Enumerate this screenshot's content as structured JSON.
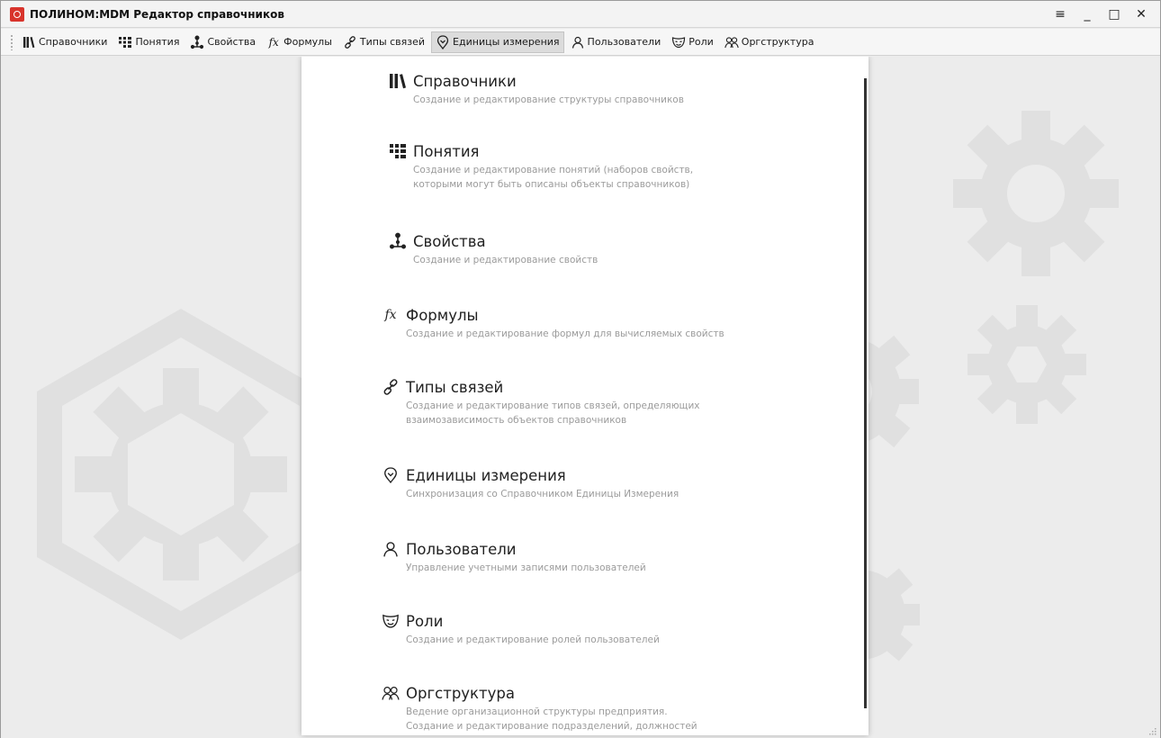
{
  "window": {
    "title": "ПОЛИНОМ:MDM Редактор справочников",
    "controls": [
      "≡",
      "_",
      "□",
      "✕"
    ]
  },
  "toolbar": {
    "items": [
      {
        "label": "Справочники",
        "icon": "books-icon"
      },
      {
        "label": "Понятия",
        "icon": "grid-icon"
      },
      {
        "label": "Свойства",
        "icon": "properties-icon"
      },
      {
        "label": "Формулы",
        "icon": "fx-icon"
      },
      {
        "label": "Типы связей",
        "icon": "link-icon"
      },
      {
        "label": "Единицы измерения",
        "icon": "measure-icon",
        "active": true
      },
      {
        "label": "Пользователи",
        "icon": "user-icon"
      },
      {
        "label": "Роли",
        "icon": "mask-icon"
      },
      {
        "label": "Оргструктура",
        "icon": "users-icon"
      }
    ]
  },
  "menu": {
    "entries": [
      {
        "title": "Справочники",
        "desc": "Создание и редактирование структуры справочников",
        "icon": "books-icon"
      },
      {
        "title": "Понятия",
        "desc": "Создание и редактирование понятий (наборов свойств,\nкоторыми могут быть описаны объекты справочников)",
        "icon": "grid-icon"
      },
      {
        "title": "Свойства",
        "desc": "Создание и редактирование свойств",
        "icon": "properties-icon"
      },
      {
        "title": "Формулы",
        "desc": "Создание и редактирование формул для вычисляемых свойств",
        "icon": "fx-icon"
      },
      {
        "title": "Типы связей",
        "desc": "Создание и редактирование типов связей, определяющих\nвзаимозависимость объектов справочников",
        "icon": "link-icon"
      },
      {
        "title": "Единицы измерения",
        "desc": "Синхронизация со Справочником Единицы Измерения",
        "icon": "measure-icon"
      },
      {
        "title": "Пользователи",
        "desc": "Управление учетными записями пользователей",
        "icon": "user-icon"
      },
      {
        "title": "Роли",
        "desc": "Создание и редактирование ролей пользователей",
        "icon": "mask-icon"
      },
      {
        "title": "Оргструктура",
        "desc": "Ведение организационной структуры предприятия.\nСоздание и редактирование подразделений, должностей",
        "icon": "users-icon"
      }
    ]
  },
  "colors": {
    "accent": "#d8342c",
    "background": "#ececec",
    "decoration": "#e0e0e0",
    "panel": "#ffffff",
    "description": "#9b9b9b"
  }
}
